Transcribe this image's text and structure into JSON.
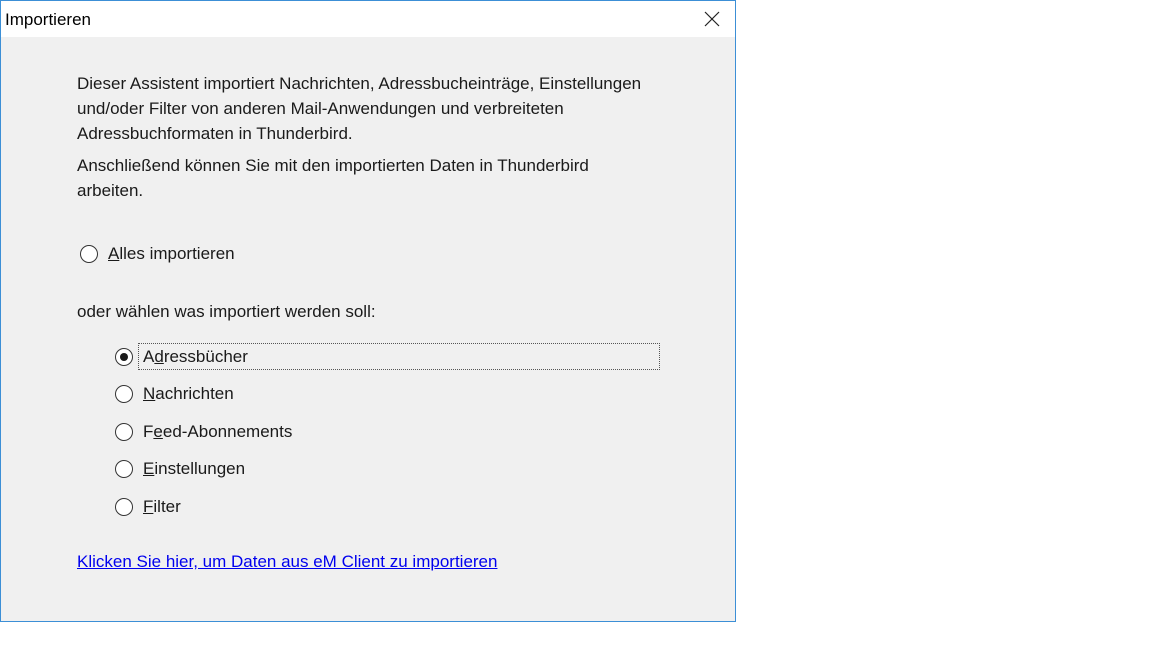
{
  "window": {
    "title": "Importieren",
    "close_icon": "close-icon"
  },
  "intro": {
    "paragraph1": "Dieser Assistent importiert Nachrichten, Adressbucheinträge, Einstellungen und/oder Filter von anderen Mail-Anwendungen und verbreiteten Adressbuchformaten in Thunderbird.",
    "paragraph2": "Anschließend können Sie mit den importierten Daten in Thunderbird arbeiten."
  },
  "import_all": {
    "accel": "A",
    "rest": "lles importieren",
    "checked": false
  },
  "choose_label": "oder wählen was importiert werden soll:",
  "options": [
    {
      "pre": "A",
      "accel": "d",
      "rest": "ressbücher",
      "checked": true
    },
    {
      "pre": "",
      "accel": "N",
      "rest": "achrichten",
      "checked": false
    },
    {
      "pre": "F",
      "accel": "e",
      "rest": "ed-Abonnements",
      "checked": false
    },
    {
      "pre": "",
      "accel": "E",
      "rest": "instellungen",
      "checked": false
    },
    {
      "pre": "",
      "accel": "F",
      "rest": "ilter",
      "checked": false
    }
  ],
  "em_client_link": "Klicken Sie hier, um Daten aus eM Client zu importieren",
  "colors": {
    "dialog_bg": "#f0f0f0",
    "border": "#3c8fd6",
    "link": "#0000ee"
  }
}
